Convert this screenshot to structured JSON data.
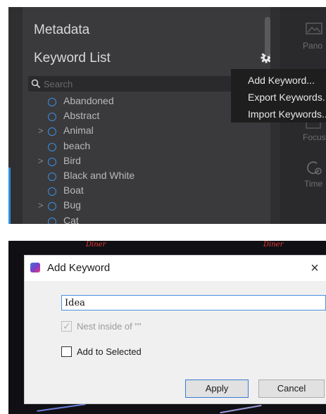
{
  "library_panel": {
    "metadata_title": "Metadata",
    "keyword_list_title": "Keyword List",
    "search": {
      "placeholder": "Search",
      "value": ""
    },
    "keywords": [
      {
        "label": "Abandoned",
        "expandable": false
      },
      {
        "label": "Abstract",
        "expandable": false
      },
      {
        "label": "Animal",
        "expandable": true
      },
      {
        "label": "beach",
        "expandable": false
      },
      {
        "label": "Bird",
        "expandable": true
      },
      {
        "label": "Black and White",
        "expandable": false
      },
      {
        "label": "Boat",
        "expandable": false
      },
      {
        "label": "Bug",
        "expandable": true
      },
      {
        "label": "Cat",
        "expandable": false
      }
    ],
    "right_column": {
      "items": [
        "Pano",
        "Focus",
        "Time"
      ]
    }
  },
  "context_menu": {
    "items": [
      "Add Keyword...",
      "Export Keywords...",
      "Import Keywords..."
    ]
  },
  "dialog": {
    "title": "Add Keyword",
    "close_label": "×",
    "keyword_value": "Idea",
    "nest_label": "Nest inside of \"\"",
    "nest_checked": true,
    "nest_disabled": true,
    "add_to_selected_label": "Add to Selected",
    "add_to_selected_checked": false,
    "apply_label": "Apply",
    "cancel_label": "Cancel"
  },
  "background_signs": [
    "Diner",
    "Diner"
  ],
  "colors": {
    "accent_blue": "#3b8fe0",
    "panel_bg": "#3a3a3c",
    "menu_bg": "#1e1e1e",
    "dialog_bg": "#f0f0f0"
  }
}
